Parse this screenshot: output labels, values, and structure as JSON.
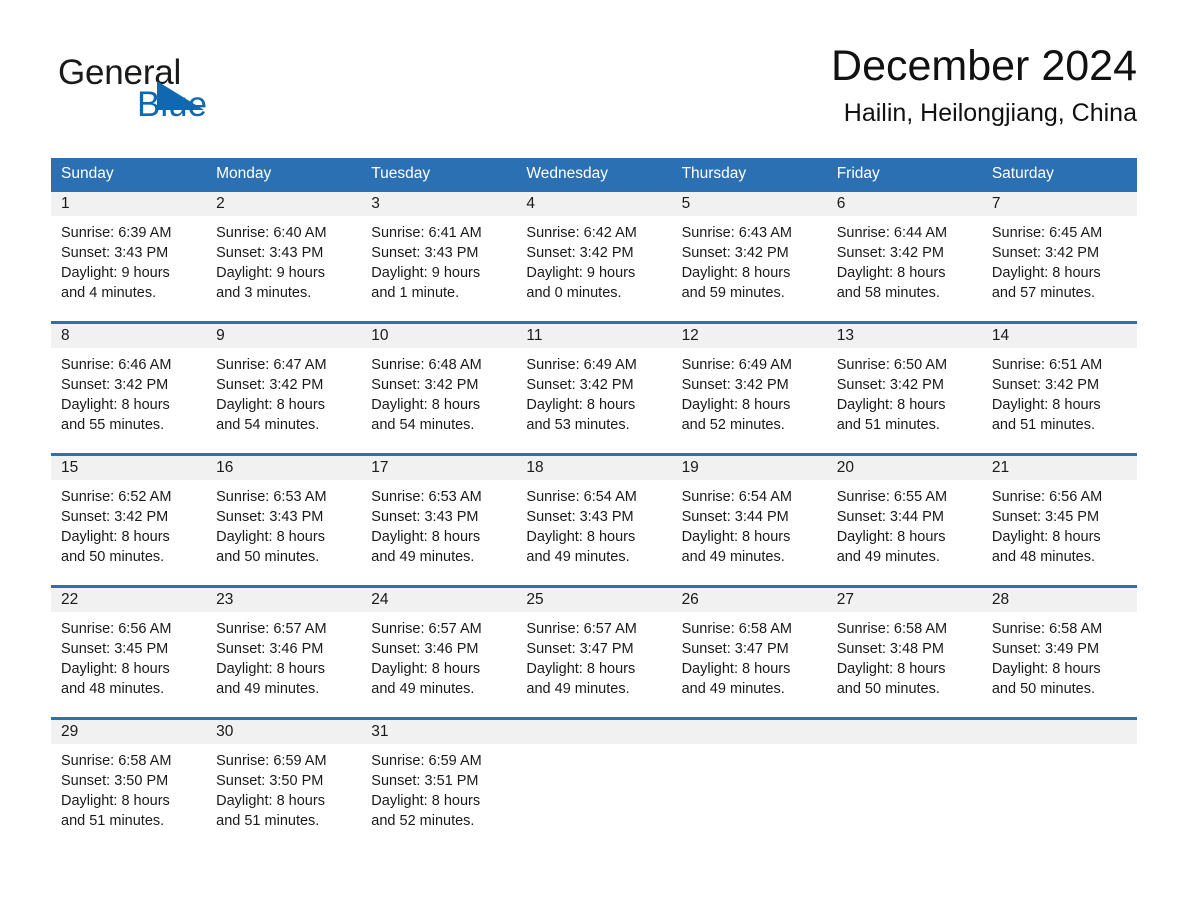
{
  "brand": {
    "name_top": "General",
    "name_bottom": "Blue",
    "accent_color": "#1068b0"
  },
  "header": {
    "title": "December 2024",
    "subtitle": "Hailin, Heilongjiang, China"
  },
  "calendar": {
    "header_bg": "#2b70b3",
    "daynum_bg": "#f1f1f1",
    "weekdays": [
      "Sunday",
      "Monday",
      "Tuesday",
      "Wednesday",
      "Thursday",
      "Friday",
      "Saturday"
    ],
    "weeks": [
      [
        {
          "day": "1",
          "sunrise": "Sunrise: 6:39 AM",
          "sunset": "Sunset: 3:43 PM",
          "daylight_line1": "Daylight: 9 hours",
          "daylight_line2": "and 4 minutes."
        },
        {
          "day": "2",
          "sunrise": "Sunrise: 6:40 AM",
          "sunset": "Sunset: 3:43 PM",
          "daylight_line1": "Daylight: 9 hours",
          "daylight_line2": "and 3 minutes."
        },
        {
          "day": "3",
          "sunrise": "Sunrise: 6:41 AM",
          "sunset": "Sunset: 3:43 PM",
          "daylight_line1": "Daylight: 9 hours",
          "daylight_line2": "and 1 minute."
        },
        {
          "day": "4",
          "sunrise": "Sunrise: 6:42 AM",
          "sunset": "Sunset: 3:42 PM",
          "daylight_line1": "Daylight: 9 hours",
          "daylight_line2": "and 0 minutes."
        },
        {
          "day": "5",
          "sunrise": "Sunrise: 6:43 AM",
          "sunset": "Sunset: 3:42 PM",
          "daylight_line1": "Daylight: 8 hours",
          "daylight_line2": "and 59 minutes."
        },
        {
          "day": "6",
          "sunrise": "Sunrise: 6:44 AM",
          "sunset": "Sunset: 3:42 PM",
          "daylight_line1": "Daylight: 8 hours",
          "daylight_line2": "and 58 minutes."
        },
        {
          "day": "7",
          "sunrise": "Sunrise: 6:45 AM",
          "sunset": "Sunset: 3:42 PM",
          "daylight_line1": "Daylight: 8 hours",
          "daylight_line2": "and 57 minutes."
        }
      ],
      [
        {
          "day": "8",
          "sunrise": "Sunrise: 6:46 AM",
          "sunset": "Sunset: 3:42 PM",
          "daylight_line1": "Daylight: 8 hours",
          "daylight_line2": "and 55 minutes."
        },
        {
          "day": "9",
          "sunrise": "Sunrise: 6:47 AM",
          "sunset": "Sunset: 3:42 PM",
          "daylight_line1": "Daylight: 8 hours",
          "daylight_line2": "and 54 minutes."
        },
        {
          "day": "10",
          "sunrise": "Sunrise: 6:48 AM",
          "sunset": "Sunset: 3:42 PM",
          "daylight_line1": "Daylight: 8 hours",
          "daylight_line2": "and 54 minutes."
        },
        {
          "day": "11",
          "sunrise": "Sunrise: 6:49 AM",
          "sunset": "Sunset: 3:42 PM",
          "daylight_line1": "Daylight: 8 hours",
          "daylight_line2": "and 53 minutes."
        },
        {
          "day": "12",
          "sunrise": "Sunrise: 6:49 AM",
          "sunset": "Sunset: 3:42 PM",
          "daylight_line1": "Daylight: 8 hours",
          "daylight_line2": "and 52 minutes."
        },
        {
          "day": "13",
          "sunrise": "Sunrise: 6:50 AM",
          "sunset": "Sunset: 3:42 PM",
          "daylight_line1": "Daylight: 8 hours",
          "daylight_line2": "and 51 minutes."
        },
        {
          "day": "14",
          "sunrise": "Sunrise: 6:51 AM",
          "sunset": "Sunset: 3:42 PM",
          "daylight_line1": "Daylight: 8 hours",
          "daylight_line2": "and 51 minutes."
        }
      ],
      [
        {
          "day": "15",
          "sunrise": "Sunrise: 6:52 AM",
          "sunset": "Sunset: 3:42 PM",
          "daylight_line1": "Daylight: 8 hours",
          "daylight_line2": "and 50 minutes."
        },
        {
          "day": "16",
          "sunrise": "Sunrise: 6:53 AM",
          "sunset": "Sunset: 3:43 PM",
          "daylight_line1": "Daylight: 8 hours",
          "daylight_line2": "and 50 minutes."
        },
        {
          "day": "17",
          "sunrise": "Sunrise: 6:53 AM",
          "sunset": "Sunset: 3:43 PM",
          "daylight_line1": "Daylight: 8 hours",
          "daylight_line2": "and 49 minutes."
        },
        {
          "day": "18",
          "sunrise": "Sunrise: 6:54 AM",
          "sunset": "Sunset: 3:43 PM",
          "daylight_line1": "Daylight: 8 hours",
          "daylight_line2": "and 49 minutes."
        },
        {
          "day": "19",
          "sunrise": "Sunrise: 6:54 AM",
          "sunset": "Sunset: 3:44 PM",
          "daylight_line1": "Daylight: 8 hours",
          "daylight_line2": "and 49 minutes."
        },
        {
          "day": "20",
          "sunrise": "Sunrise: 6:55 AM",
          "sunset": "Sunset: 3:44 PM",
          "daylight_line1": "Daylight: 8 hours",
          "daylight_line2": "and 49 minutes."
        },
        {
          "day": "21",
          "sunrise": "Sunrise: 6:56 AM",
          "sunset": "Sunset: 3:45 PM",
          "daylight_line1": "Daylight: 8 hours",
          "daylight_line2": "and 48 minutes."
        }
      ],
      [
        {
          "day": "22",
          "sunrise": "Sunrise: 6:56 AM",
          "sunset": "Sunset: 3:45 PM",
          "daylight_line1": "Daylight: 8 hours",
          "daylight_line2": "and 48 minutes."
        },
        {
          "day": "23",
          "sunrise": "Sunrise: 6:57 AM",
          "sunset": "Sunset: 3:46 PM",
          "daylight_line1": "Daylight: 8 hours",
          "daylight_line2": "and 49 minutes."
        },
        {
          "day": "24",
          "sunrise": "Sunrise: 6:57 AM",
          "sunset": "Sunset: 3:46 PM",
          "daylight_line1": "Daylight: 8 hours",
          "daylight_line2": "and 49 minutes."
        },
        {
          "day": "25",
          "sunrise": "Sunrise: 6:57 AM",
          "sunset": "Sunset: 3:47 PM",
          "daylight_line1": "Daylight: 8 hours",
          "daylight_line2": "and 49 minutes."
        },
        {
          "day": "26",
          "sunrise": "Sunrise: 6:58 AM",
          "sunset": "Sunset: 3:47 PM",
          "daylight_line1": "Daylight: 8 hours",
          "daylight_line2": "and 49 minutes."
        },
        {
          "day": "27",
          "sunrise": "Sunrise: 6:58 AM",
          "sunset": "Sunset: 3:48 PM",
          "daylight_line1": "Daylight: 8 hours",
          "daylight_line2": "and 50 minutes."
        },
        {
          "day": "28",
          "sunrise": "Sunrise: 6:58 AM",
          "sunset": "Sunset: 3:49 PM",
          "daylight_line1": "Daylight: 8 hours",
          "daylight_line2": "and 50 minutes."
        }
      ],
      [
        {
          "day": "29",
          "sunrise": "Sunrise: 6:58 AM",
          "sunset": "Sunset: 3:50 PM",
          "daylight_line1": "Daylight: 8 hours",
          "daylight_line2": "and 51 minutes."
        },
        {
          "day": "30",
          "sunrise": "Sunrise: 6:59 AM",
          "sunset": "Sunset: 3:50 PM",
          "daylight_line1": "Daylight: 8 hours",
          "daylight_line2": "and 51 minutes."
        },
        {
          "day": "31",
          "sunrise": "Sunrise: 6:59 AM",
          "sunset": "Sunset: 3:51 PM",
          "daylight_line1": "Daylight: 8 hours",
          "daylight_line2": "and 52 minutes."
        },
        {
          "day": "",
          "sunrise": "",
          "sunset": "",
          "daylight_line1": "",
          "daylight_line2": ""
        },
        {
          "day": "",
          "sunrise": "",
          "sunset": "",
          "daylight_line1": "",
          "daylight_line2": ""
        },
        {
          "day": "",
          "sunrise": "",
          "sunset": "",
          "daylight_line1": "",
          "daylight_line2": ""
        },
        {
          "day": "",
          "sunrise": "",
          "sunset": "",
          "daylight_line1": "",
          "daylight_line2": ""
        }
      ]
    ]
  }
}
